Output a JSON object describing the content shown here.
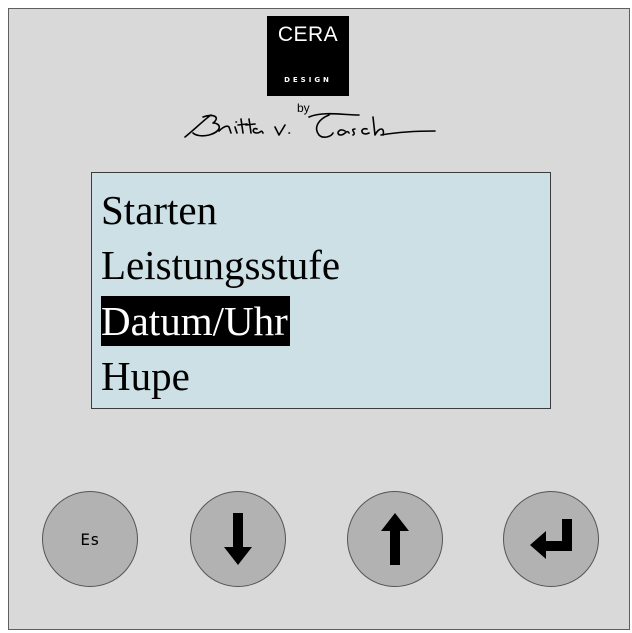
{
  "logo": {
    "brand": "CERA",
    "sub": "DESIGN",
    "by": "by",
    "signature": "Britta v. Tasch"
  },
  "display": {
    "menu": [
      {
        "label": "Starten",
        "selected": false
      },
      {
        "label": "Leistungsstufe",
        "selected": false
      },
      {
        "label": "Datum/Uhr",
        "selected": true
      },
      {
        "label": "Hupe",
        "selected": false
      }
    ]
  },
  "buttons": {
    "escape_label": "Es",
    "down_icon": "arrow-down-icon",
    "up_icon": "arrow-up-icon",
    "enter_icon": "enter-icon"
  },
  "colors": {
    "panel": "#d9d9d9",
    "display": "#cce0e5",
    "button": "#b2b2b2",
    "highlight": "#000000"
  }
}
